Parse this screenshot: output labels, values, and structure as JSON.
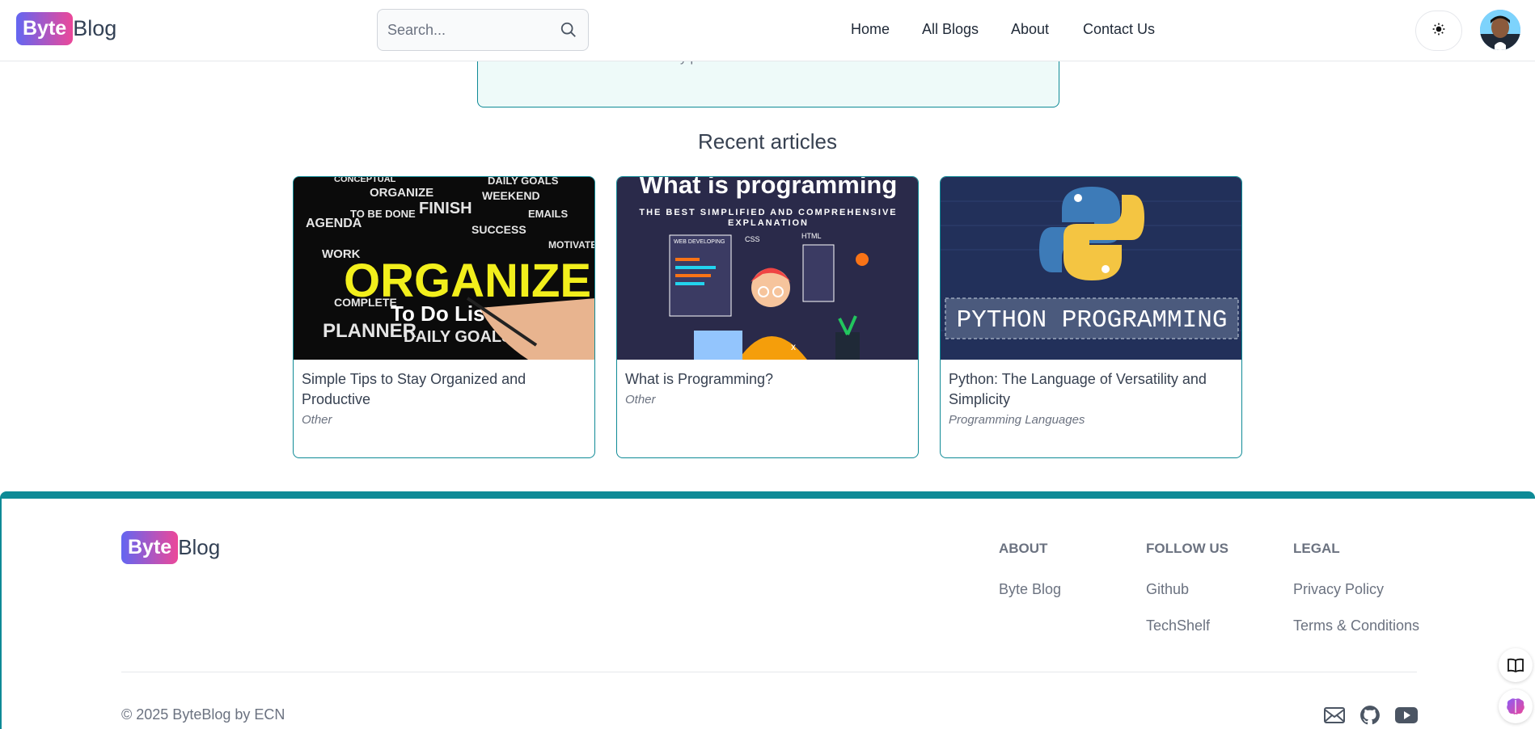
{
  "header": {
    "logo": {
      "byte": "Byte",
      "blog": "Blog"
    },
    "search": {
      "placeholder": "Search..."
    },
    "nav": [
      {
        "label": "Home"
      },
      {
        "label": "All Blogs"
      },
      {
        "label": "About"
      },
      {
        "label": "Contact Us"
      }
    ],
    "theme_icon": "sun-icon",
    "avatar_icon": "user-avatar"
  },
  "hero": {
    "faded_text": "y p"
  },
  "recent": {
    "title": "Recent articles",
    "cards": [
      {
        "title": "Simple Tips to Stay Organized and Productive",
        "category": "Other",
        "image": "organize-image"
      },
      {
        "title": "What is Programming?",
        "category": "Other",
        "image": "programming-image"
      },
      {
        "title": "Python: The Language of Versatility and Simplicity",
        "category": "Programming Languages",
        "image": "python-image"
      }
    ]
  },
  "images": {
    "organize": {
      "big": "ORGANIZE",
      "todo": "To Do List",
      "planner": "PLANNER",
      "daily": "DAILY GOALS",
      "finish": "FINISH",
      "agenda": "AGENDA",
      "work": "WORK",
      "weekend": "WEEKEND",
      "emails": "EMAILS",
      "success": "SUCCESS",
      "complete": "COMPLETE",
      "to_be_done": "TO BE DONE",
      "conceptual": "CONCEPTUAL",
      "motivate": "MOTIVATE"
    },
    "programming": {
      "headline": "What is programming",
      "sub1": "THE BEST SIMPLIFIED AND COMPREHENSIVE",
      "sub2": "EXPLANATION",
      "web": "WEB DEVELOPING",
      "css": "CSS",
      "html": "HTML"
    },
    "python": {
      "banner": "PYTHON PROGRAMMING"
    }
  },
  "footer": {
    "logo": {
      "byte": "Byte",
      "blog": "Blog"
    },
    "columns": [
      {
        "heading": "ABOUT",
        "links": [
          "Byte Blog"
        ]
      },
      {
        "heading": "FOLLOW US",
        "links": [
          "Github",
          "TechShelf"
        ]
      },
      {
        "heading": "LEGAL",
        "links": [
          "Privacy Policy",
          "Terms & Conditions"
        ]
      }
    ],
    "copyright": "© 2025 ByteBlog by ECN",
    "social_icons": [
      "mail-icon",
      "github-icon",
      "youtube-icon"
    ]
  },
  "colors": {
    "accent": "#0e8a96",
    "logo_gradient_start": "#6366f1",
    "logo_gradient_end": "#ec4899"
  }
}
